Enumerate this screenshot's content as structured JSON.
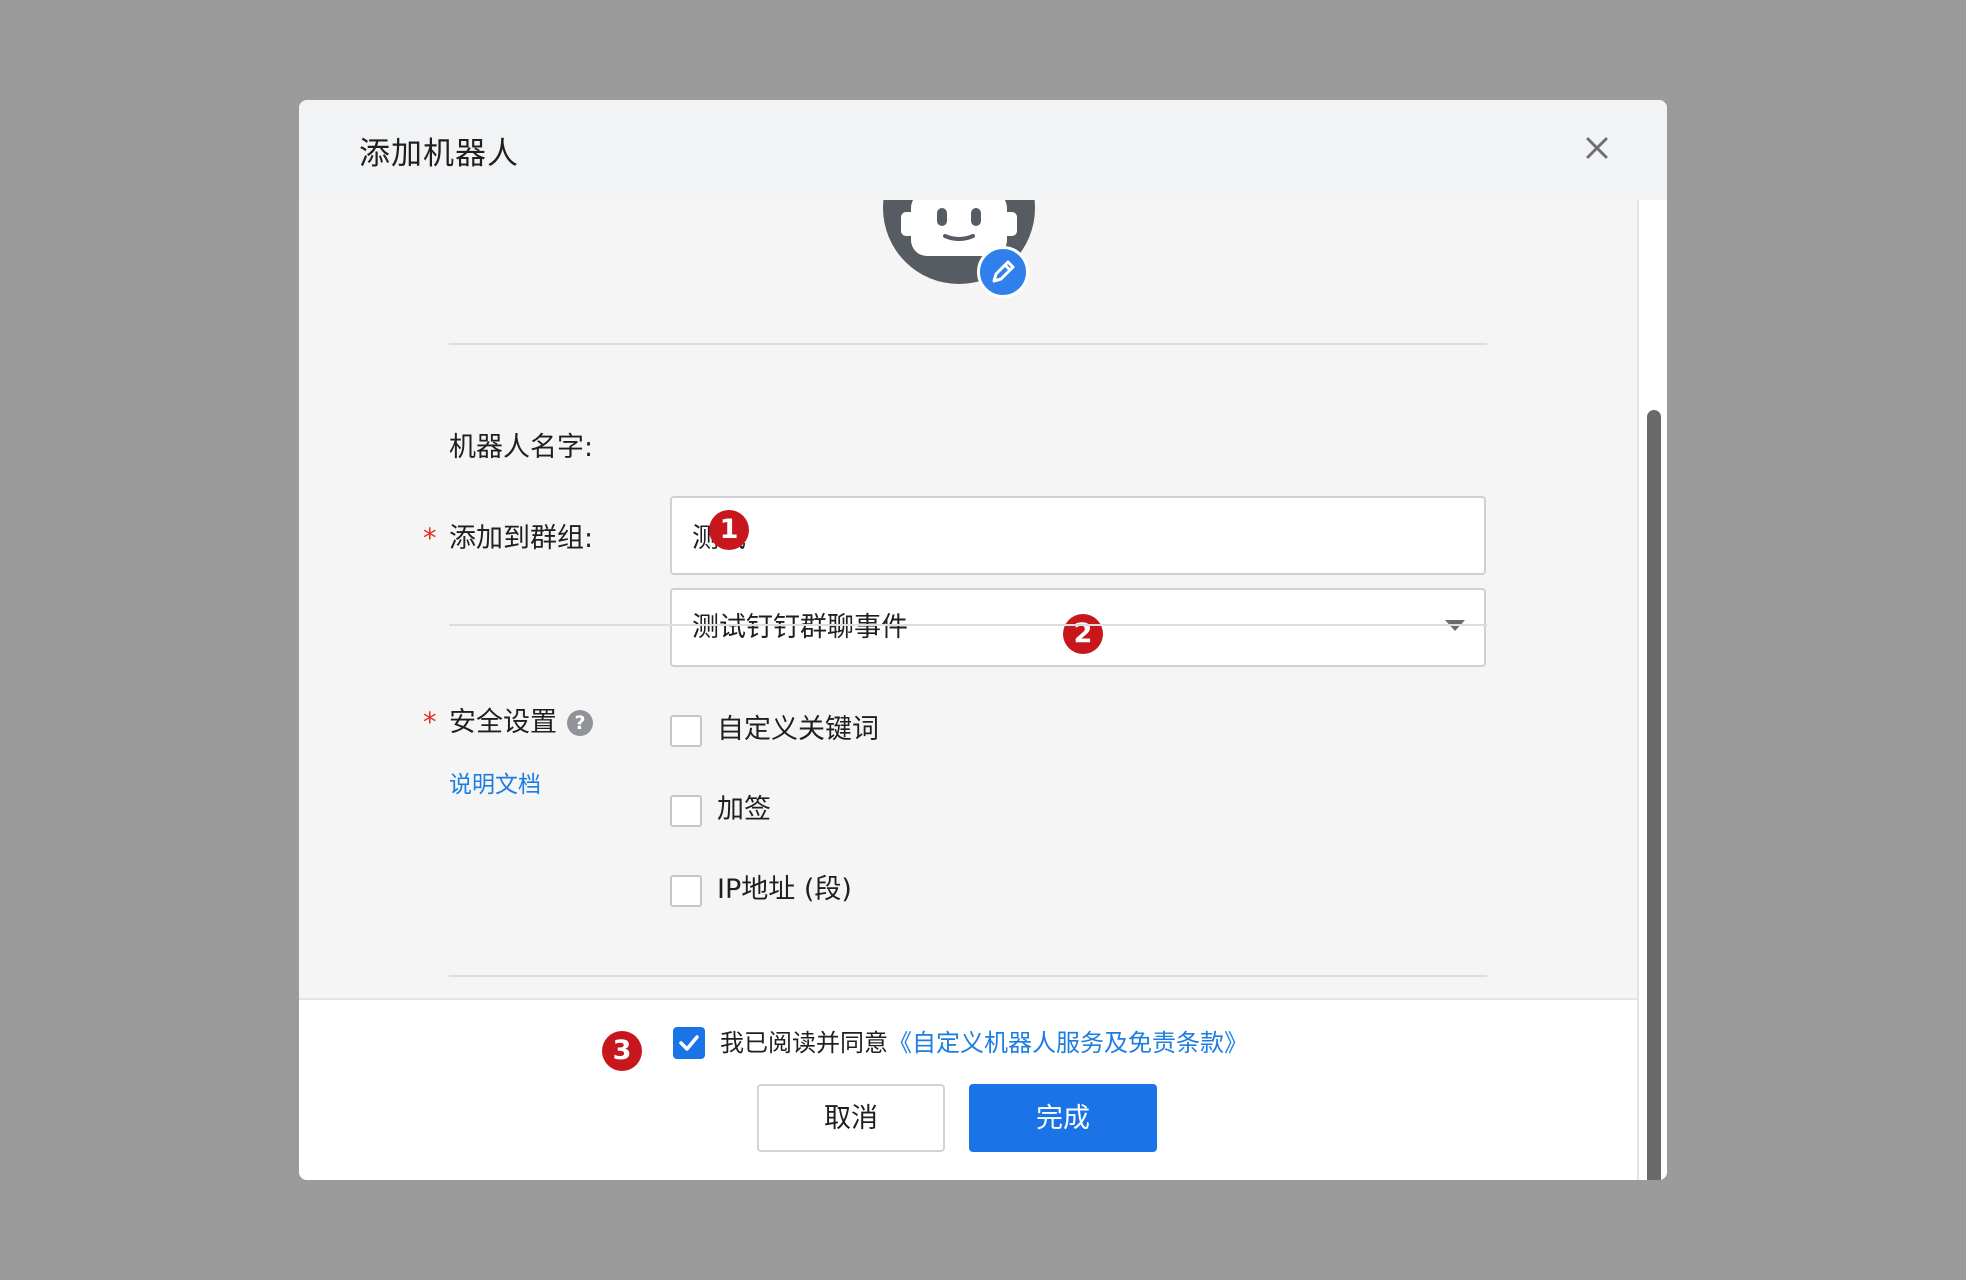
{
  "dialog": {
    "title": "添加机器人",
    "close_icon": "close-icon"
  },
  "avatar": {
    "icon": "robot-face-icon",
    "edit_icon": "pencil-icon"
  },
  "form": {
    "name_label": "机器人名字:",
    "name_value": "测试",
    "group_required_mark": "*",
    "group_label": "添加到群组:",
    "group_value": "测试钉钉群聊事件",
    "security_required_mark": "*",
    "security_label": "安全设置",
    "help_icon_glyph": "?",
    "doc_link": "说明文档",
    "security_options": [
      {
        "label": "自定义关键词",
        "checked": false
      },
      {
        "label": "加签",
        "checked": false
      },
      {
        "label": "IP地址 (段)",
        "checked": false
      }
    ]
  },
  "footer": {
    "agree_checked": true,
    "agree_text": "我已阅读并同意",
    "agree_link": "《自定义机器人服务及免责条款》",
    "cancel_label": "取消",
    "done_label": "完成"
  },
  "annotations": [
    "1",
    "2",
    "3"
  ],
  "colors": {
    "accent": "#1a74e8",
    "link": "#1e7de0",
    "marker": "#c8161d",
    "required": "#e02e24"
  }
}
